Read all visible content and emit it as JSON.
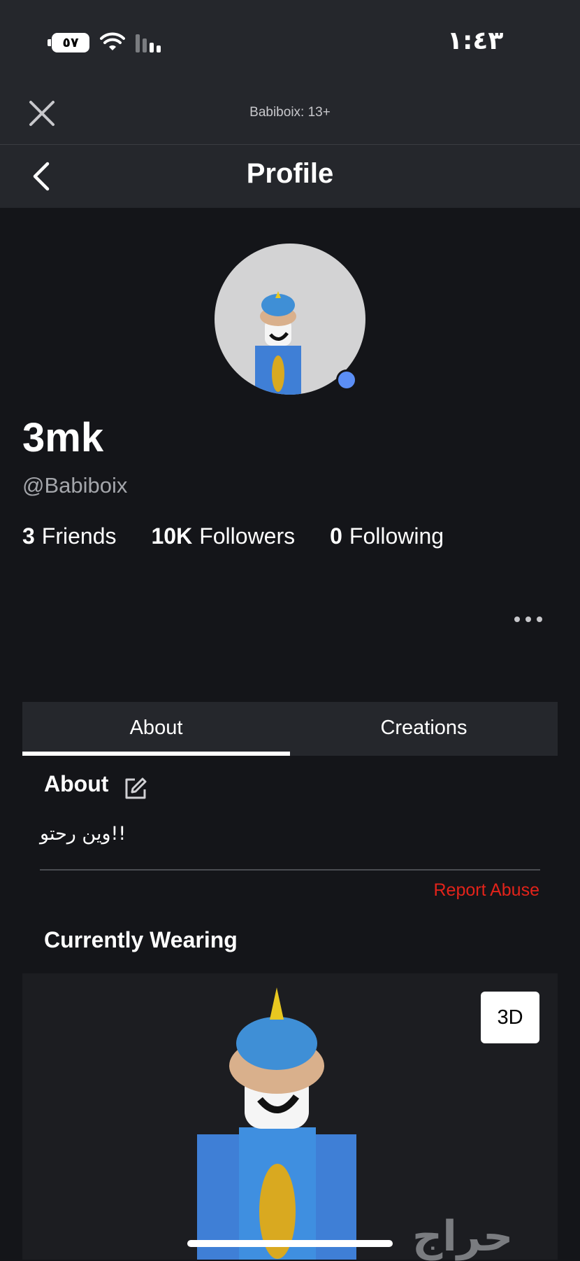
{
  "status_bar": {
    "time": "١:٤٣",
    "battery": "٥٧"
  },
  "header": {
    "age_label": "Babiboix: 13+",
    "title": "Profile"
  },
  "profile": {
    "display_name": "3mk",
    "username": "@Babiboix",
    "stats": {
      "friends_count": "3",
      "friends_label": "Friends",
      "followers_count": "10K",
      "followers_label": "Followers",
      "following_count": "0",
      "following_label": "Following"
    },
    "online": true
  },
  "tabs": [
    {
      "label": "About",
      "active": true
    },
    {
      "label": "Creations",
      "active": false
    }
  ],
  "about": {
    "title": "About",
    "text": "!!وين رحتو",
    "report_label": "Report Abuse"
  },
  "wearing": {
    "title": "Currently Wearing",
    "view_3d_label": "3D"
  },
  "watermark": "حراج",
  "colors": {
    "background": "#141519",
    "bar": "#25272c",
    "report": "#e2231a",
    "online": "#5b8ef5"
  }
}
